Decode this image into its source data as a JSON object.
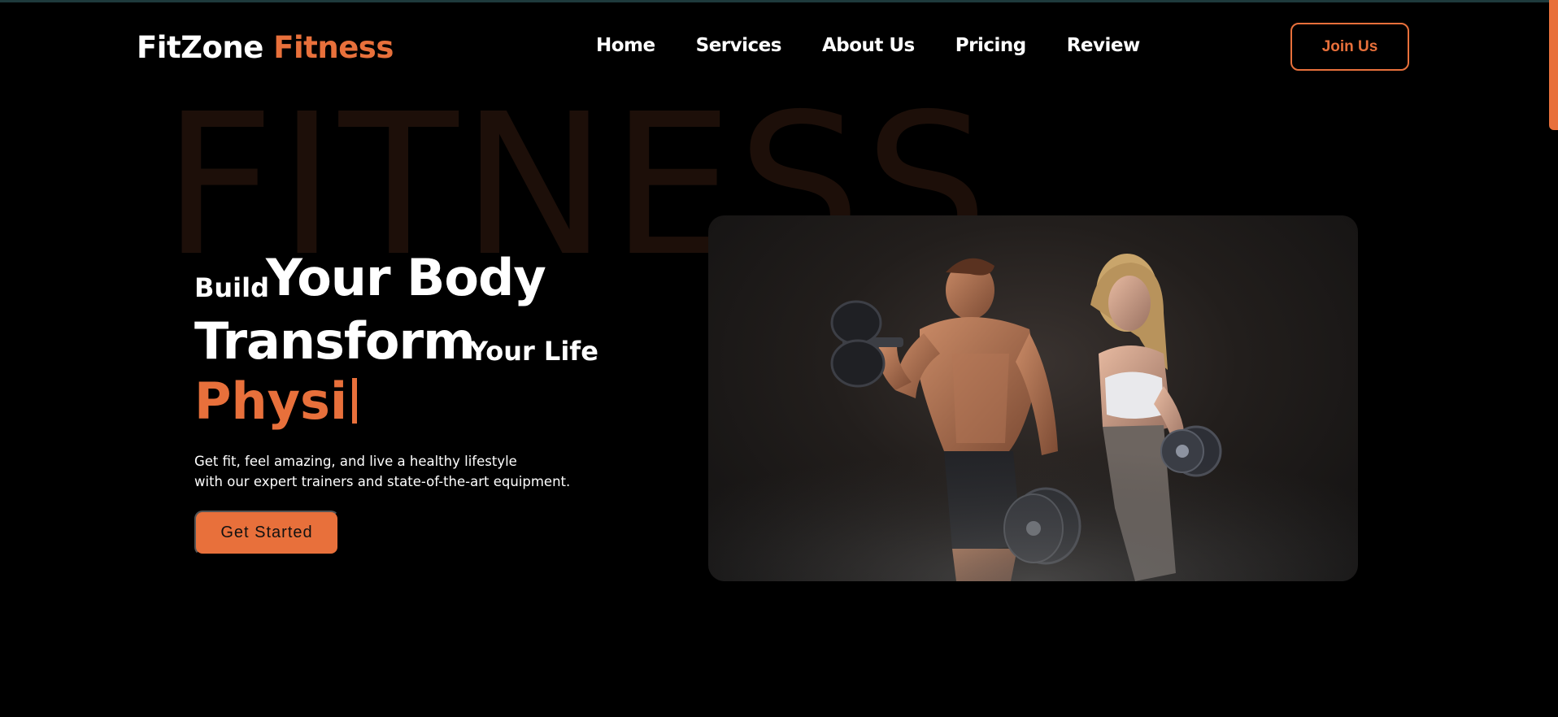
{
  "brand": {
    "name": "FitZone",
    "accent": "Fitness"
  },
  "nav": {
    "links": [
      "Home",
      "Services",
      "About Us",
      "Pricing",
      "Review"
    ],
    "cta": "Join Us"
  },
  "hero": {
    "background_word": "FITNESS",
    "line1": {
      "small": "Build",
      "big": "Your Body"
    },
    "line2": {
      "big": "Transform",
      "small": "Your Life"
    },
    "typing_text": "Physi",
    "description_line1": "Get fit, feel amazing, and live a healthy lifestyle",
    "description_line2": "with our expert trainers and state-of-the-art equipment.",
    "button": "Get Started"
  },
  "colors": {
    "accent": "#e8703b",
    "background": "#000000",
    "text": "#ffffff"
  }
}
